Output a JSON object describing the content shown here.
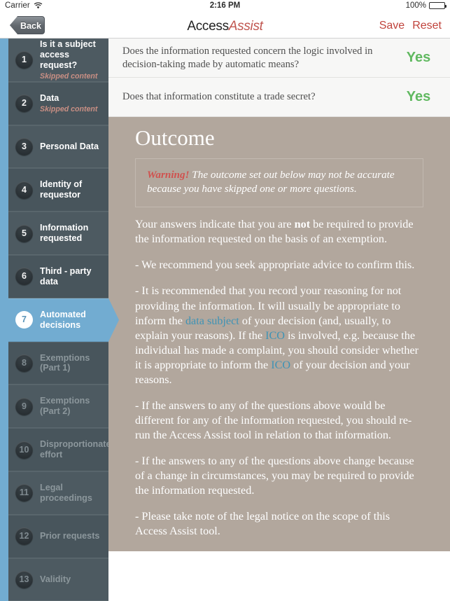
{
  "statusbar": {
    "carrier": "Carrier",
    "wifi_icon": "wifi-icon",
    "time": "2:16 PM",
    "battery_percent": "100%",
    "battery_icon": "battery-full-icon"
  },
  "navbar": {
    "back_label": "Back",
    "title_part1": "Access",
    "title_part2": "Assist",
    "save_label": "Save",
    "reset_label": "Reset",
    "accent_color": "#c0433c"
  },
  "sidebar": {
    "rail_color": "#72acd1",
    "active_color": "#72acd1",
    "skipped_label": "Skipped content",
    "items": [
      {
        "num": "1",
        "label": "Is it a subject access request?",
        "sub": "Skipped content",
        "state": "skipped"
      },
      {
        "num": "2",
        "label": "Data",
        "sub": "Skipped content",
        "state": "skipped"
      },
      {
        "num": "3",
        "label": "Personal Data",
        "sub": "",
        "state": "done"
      },
      {
        "num": "4",
        "label": "Identity of requestor",
        "sub": "",
        "state": "done"
      },
      {
        "num": "5",
        "label": "Information requested",
        "sub": "",
        "state": "done"
      },
      {
        "num": "6",
        "label": "Third - party data",
        "sub": "",
        "state": "done"
      },
      {
        "num": "7",
        "label": "Automated decisions",
        "sub": "",
        "state": "active"
      },
      {
        "num": "8",
        "label": "Exemptions (Part 1)",
        "sub": "",
        "state": "disabled"
      },
      {
        "num": "9",
        "label": "Exemptions (Part 2)",
        "sub": "",
        "state": "disabled"
      },
      {
        "num": "10",
        "label": "Disproportionate effort",
        "sub": "",
        "state": "disabled"
      },
      {
        "num": "11",
        "label": "Legal proceedings",
        "sub": "",
        "state": "disabled"
      },
      {
        "num": "12",
        "label": "Prior requests",
        "sub": "",
        "state": "disabled"
      },
      {
        "num": "13",
        "label": "Validity",
        "sub": "",
        "state": "disabled"
      }
    ]
  },
  "main": {
    "questions": [
      {
        "question": "Does the information requested concern the logic involved in decision-taking made by automatic means?",
        "answer": "Yes"
      },
      {
        "question": "Does that information constitute a trade secret?",
        "answer": "Yes"
      }
    ],
    "answer_color": "#61b961",
    "outcome": {
      "title": "Outcome",
      "panel_color": "#b2a79d",
      "warning_lead": "Warning!",
      "warning_body": "The outcome set out below may not be accurate because you have skipped one or more questions.",
      "warning_color": "#d0524f",
      "link_color": "#3f93b5",
      "paragraphs": [
        {
          "id": "p1",
          "pre": "Your answers indicate that you are ",
          "bold": "not",
          "post": " be required to provide the information requested on the basis of an exemption."
        },
        {
          "id": "p2",
          "text": "- We recommend you seek appropriate advice to confirm this."
        },
        {
          "id": "p3",
          "seg1": "- It is recommended that you record your reasoning for not providing the information. It will usually be appropriate to inform the ",
          "link1": "data subject",
          "seg2": " of your decision (and, usually, to explain your reasons). If the ",
          "link2": "ICO",
          "seg3": " is involved, e.g. because the individual has made a complaint, you should consider whether it is appropriate to inform the ",
          "link3": "ICO",
          "seg4": " of your decision and your reasons."
        },
        {
          "id": "p4",
          "text": "- If the answers to any of the questions above would be different for any of the information requested, you should re-run the Access Assist tool in relation to that information."
        },
        {
          "id": "p5",
          "text": "- If the answers to any of the questions above change because of a change in circumstances, you may be required to provide the information requested."
        },
        {
          "id": "p6",
          "text": "- Please take note of the legal notice on the scope of this Access Assist tool."
        }
      ]
    }
  }
}
